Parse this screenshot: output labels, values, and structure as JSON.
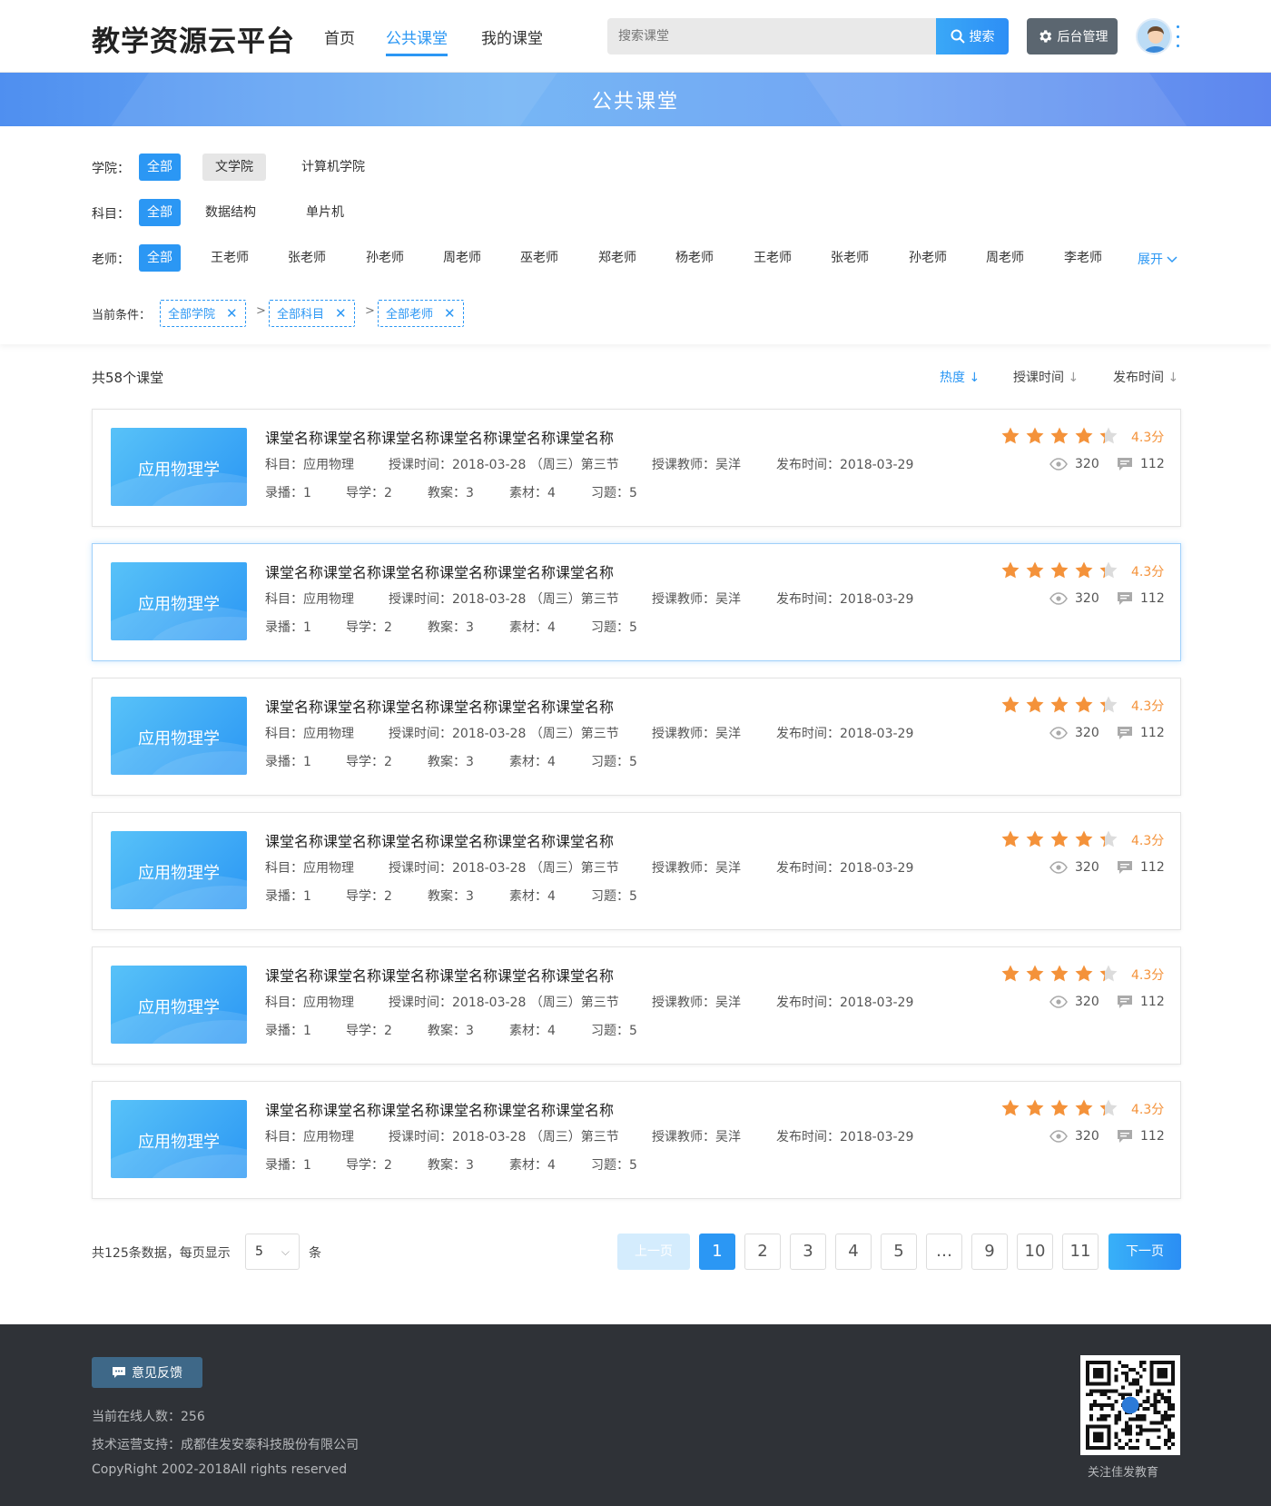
{
  "header": {
    "logo": "教学资源云平台",
    "nav": [
      "首页",
      "公共课堂",
      "我的课堂"
    ],
    "active_nav": "公共课堂",
    "search_placeholder": "搜索课堂",
    "search_label": "搜索",
    "admin_label": "后台管理"
  },
  "banner": {
    "title": "公共课堂"
  },
  "filters": {
    "college_label": "学院：",
    "colleges": [
      "全部",
      "文学院",
      "计算机学院"
    ],
    "subject_label": "科目：",
    "subjects": [
      "全部",
      "数据结构",
      "单片机"
    ],
    "teacher_label": "老师：",
    "teachers": [
      "全部",
      "王老师",
      "张老师",
      "孙老师",
      "周老师",
      "巫老师",
      "郑老师",
      "杨老师",
      "王老师",
      "张老师",
      "孙老师",
      "周老师",
      "李老师"
    ],
    "expand_label": "展开",
    "conditions_label": "当前条件：",
    "conditions": [
      "全部学院",
      "全部科目",
      "全部老师"
    ],
    "separator": ">"
  },
  "list": {
    "count_text": "共58个课堂",
    "sorts": [
      "热度",
      "授课时间",
      "发布时间"
    ],
    "active_sort": "热度"
  },
  "courses": [
    {
      "thumb": "应用物理学",
      "title": "课堂名称课堂名称课堂名称课堂名称课堂名称课堂名称",
      "subject": "科目：应用物理",
      "lesson_time": "授课时间：2018-03-28 （周三）第三节",
      "teacher": "授课教师：吴洋",
      "publish_time": "发布时间：2018-03-29",
      "recording": "录播：1",
      "guide": "导学：2",
      "plan": "教案：3",
      "material": "素材：4",
      "exercise": "习题：5",
      "rating": 4.3,
      "score": "4.3分",
      "views": "320",
      "comments": "112"
    },
    {
      "thumb": "应用物理学",
      "title": "课堂名称课堂名称课堂名称课堂名称课堂名称课堂名称",
      "subject": "科目：应用物理",
      "lesson_time": "授课时间：2018-03-28 （周三）第三节",
      "teacher": "授课教师：吴洋",
      "publish_time": "发布时间：2018-03-29",
      "recording": "录播：1",
      "guide": "导学：2",
      "plan": "教案：3",
      "material": "素材：4",
      "exercise": "习题：5",
      "rating": 4.3,
      "score": "4.3分",
      "views": "320",
      "comments": "112"
    },
    {
      "thumb": "应用物理学",
      "title": "课堂名称课堂名称课堂名称课堂名称课堂名称课堂名称",
      "subject": "科目：应用物理",
      "lesson_time": "授课时间：2018-03-28 （周三）第三节",
      "teacher": "授课教师：吴洋",
      "publish_time": "发布时间：2018-03-29",
      "recording": "录播：1",
      "guide": "导学：2",
      "plan": "教案：3",
      "material": "素材：4",
      "exercise": "习题：5",
      "rating": 4.3,
      "score": "4.3分",
      "views": "320",
      "comments": "112"
    },
    {
      "thumb": "应用物理学",
      "title": "课堂名称课堂名称课堂名称课堂名称课堂名称课堂名称",
      "subject": "科目：应用物理",
      "lesson_time": "授课时间：2018-03-28 （周三）第三节",
      "teacher": "授课教师：吴洋",
      "publish_time": "发布时间：2018-03-29",
      "recording": "录播：1",
      "guide": "导学：2",
      "plan": "教案：3",
      "material": "素材：4",
      "exercise": "习题：5",
      "rating": 4.3,
      "score": "4.3分",
      "views": "320",
      "comments": "112"
    },
    {
      "thumb": "应用物理学",
      "title": "课堂名称课堂名称课堂名称课堂名称课堂名称课堂名称",
      "subject": "科目：应用物理",
      "lesson_time": "授课时间：2018-03-28 （周三）第三节",
      "teacher": "授课教师：吴洋",
      "publish_time": "发布时间：2018-03-29",
      "recording": "录播：1",
      "guide": "导学：2",
      "plan": "教案：3",
      "material": "素材：4",
      "exercise": "习题：5",
      "rating": 4.3,
      "score": "4.3分",
      "views": "320",
      "comments": "112"
    },
    {
      "thumb": "应用物理学",
      "title": "课堂名称课堂名称课堂名称课堂名称课堂名称课堂名称",
      "subject": "科目：应用物理",
      "lesson_time": "授课时间：2018-03-28 （周三）第三节",
      "teacher": "授课教师：吴洋",
      "publish_time": "发布时间：2018-03-29",
      "recording": "录播：1",
      "guide": "导学：2",
      "plan": "教案：3",
      "material": "素材：4",
      "exercise": "习题：5",
      "rating": 4.3,
      "score": "4.3分",
      "views": "320",
      "comments": "112"
    }
  ],
  "pagination": {
    "total_text": "共125条数据，每页显示",
    "page_size": "5",
    "unit": "条",
    "prev": "上一页",
    "next": "下一页",
    "pages": [
      "1",
      "2",
      "3",
      "4",
      "5",
      "…",
      "9",
      "10",
      "11"
    ],
    "current": "1"
  },
  "footer": {
    "feedback": "意见反馈",
    "online": "当前在线人数：256",
    "support": "技术运营支持：成都佳发安泰科技股份有限公司",
    "copyright": "CopyRight 2002-2018All rights reserved",
    "qr_caption": "关注佳发教育"
  },
  "colors": {
    "accent": "#2b97f4",
    "star": "#f4923a",
    "star_empty": "#dcdcdc",
    "footer_bg": "#2f3237"
  },
  "icons": [
    "search-icon",
    "gear-icon",
    "avatar",
    "more-icon",
    "chevron-down-icon",
    "close-icon",
    "arrow-down-icon",
    "star-icon",
    "eye-icon",
    "comment-icon",
    "feedback-icon",
    "qr-code"
  ]
}
